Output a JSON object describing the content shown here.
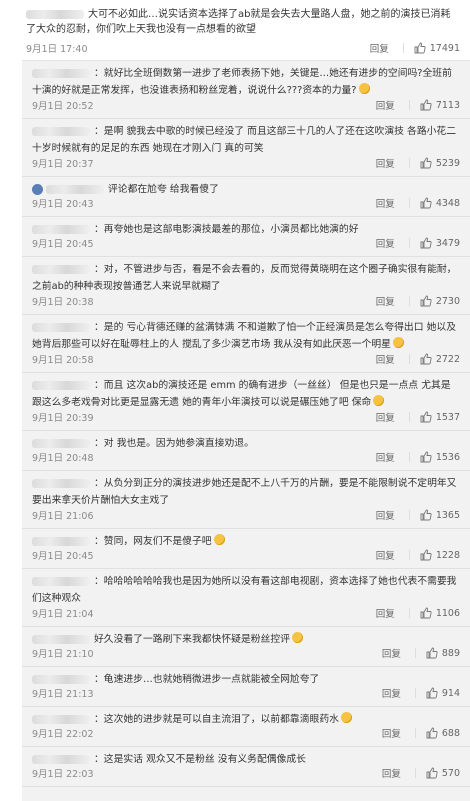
{
  "top_comment": {
    "text": "大可不必如此…说实话资本选择了ab就是会失去大量路人盘，她之前的演技已消耗了大众的忍耐，你们吹上天我也没有一点想看的欲望",
    "time": "9月1日 17:40",
    "reply_label": "回复",
    "likes": "17491"
  },
  "replies": [
    {
      "text": "：就好比全班倒数第一进步了老师表扬下她，关键是…她还有进步的空间吗?全班前十演的好就是正常发挥，也没谁表扬和粉丝宠着，说说什么???资本的力量?",
      "emoji": true,
      "time": "9月1日 20:52",
      "reply_label": "回复",
      "likes": "7113"
    },
    {
      "text": "：是啊 貌我去中歌的时候已经没了 而且这部三十几的人了还在这吹演技 各路小花二十岁时候就有的足足的东西 她现在才刚入门 真的可笑",
      "emoji": false,
      "time": "9月1日 20:37",
      "reply_label": "回复",
      "likes": "5239"
    },
    {
      "text": "评论都在尬夸  给我看傻了",
      "emoji": false,
      "avatar": true,
      "time": "9月1日 20:43",
      "reply_label": "回复",
      "likes": "4348"
    },
    {
      "text": "：再夸她也是这部电影演技最差的那位，小演员都比她演的好",
      "emoji": false,
      "time": "9月1日 20:45",
      "reply_label": "回复",
      "likes": "3479"
    },
    {
      "text": "：对，不管进步与否，看是不会去看的，反而觉得黄晓明在这个圈子确实很有能耐，之前ab的种种表现按普通艺人来说早就糊了",
      "emoji": false,
      "time": "9月1日 20:38",
      "reply_label": "回复",
      "likes": "2730"
    },
    {
      "text": "：是的 亏心背德还赚的盆满钵满 不和道歉了怕一个正经演员是怎么夸得出口 她以及她背后那些可以好在耻辱柱上的人 搅乱了多少演艺市场 我从没有如此厌恶一个明星",
      "emoji": true,
      "time": "9月1日 20:58",
      "reply_label": "回复",
      "likes": "2722"
    },
    {
      "text": "：而且 这次ab的演技还是 emm 的确有进步（一丝丝） 但是也只是一点点 尤其是跟这么多老戏骨对比更是显露无遗 她的青年小年演技可以说是碾压她了吧 保命",
      "emoji": true,
      "time": "9月1日 20:39",
      "reply_label": "回复",
      "likes": "1537"
    },
    {
      "text": "：对 我也是。因为她参演直接劝退。",
      "emoji": false,
      "time": "9月1日 20:48",
      "reply_label": "回复",
      "likes": "1536"
    },
    {
      "text": "：从负分到正分的演技进步她还是配不上八千万的片酬，要是不能限制说不定明年又要出来拿天价片酬怕大女主戏了",
      "emoji": false,
      "time": "9月1日 21:06",
      "reply_label": "回复",
      "likes": "1365"
    },
    {
      "text": "：赞同，网友们不是傻子吧",
      "emoji": true,
      "time": "9月1日 20:45",
      "reply_label": "回复",
      "likes": "1228"
    },
    {
      "text": "：哈哈哈哈哈哈我也是因为她所以没有看这部电视剧，资本选择了她也代表不需要我们这种观众",
      "emoji": false,
      "time": "9月1日 21:04",
      "reply_label": "回复",
      "likes": "1106"
    },
    {
      "text": "好久没看了一路刷下来我都快怀疑是粉丝控评",
      "emoji": true,
      "time": "9月1日 21:10",
      "reply_label": "回复",
      "likes": "889"
    },
    {
      "text": "：龟速进步…也就她稍微进步一点就能被全网尬夸了",
      "emoji": false,
      "time": "9月1日 21:13",
      "reply_label": "回复",
      "likes": "914"
    },
    {
      "text": "：这次她的进步就是可以自主流泪了，以前都靠滴眼药水",
      "emoji": true,
      "time": "9月1日 22:02",
      "reply_label": "回复",
      "likes": "688"
    },
    {
      "text": "：这是实话 观众又不是粉丝 没有义务配偶像成长",
      "emoji": false,
      "time": "9月1日 22:03",
      "reply_label": "回复",
      "likes": "570"
    }
  ]
}
